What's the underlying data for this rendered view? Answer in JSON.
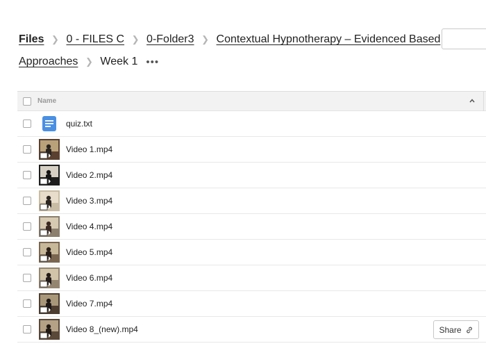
{
  "breadcrumb": {
    "items": [
      "Files",
      "0 - FILES C",
      "0-Folder3",
      "Contextual Hypnotherapy – Evidenced Based",
      "Approaches"
    ],
    "current": "Week 1",
    "more": "•••"
  },
  "table": {
    "header_name": "Name",
    "files": [
      {
        "name": "quiz.txt",
        "kind": "document"
      },
      {
        "name": "Video 1.mp4",
        "kind": "video"
      },
      {
        "name": "Video 2.mp4",
        "kind": "video"
      },
      {
        "name": "Video 3.mp4",
        "kind": "video"
      },
      {
        "name": "Video 4.mp4",
        "kind": "video"
      },
      {
        "name": "Video 5.mp4",
        "kind": "video"
      },
      {
        "name": "Video 6.mp4",
        "kind": "video"
      },
      {
        "name": "Video 7.mp4",
        "kind": "video"
      },
      {
        "name": "Video 8_(new).mp4",
        "kind": "video"
      }
    ]
  },
  "share_button": "Share",
  "icons": {
    "document": "text-document-icon",
    "video": "video-thumbnail-icon",
    "sort": "chevron-up-icon",
    "share": "link-icon",
    "separator": "chevron-right-icon",
    "more": "more-options-icon"
  },
  "colors": {
    "doc_icon": "#4a90e2",
    "header_bg": "#f2f2f2",
    "border": "#e8e8e8"
  }
}
